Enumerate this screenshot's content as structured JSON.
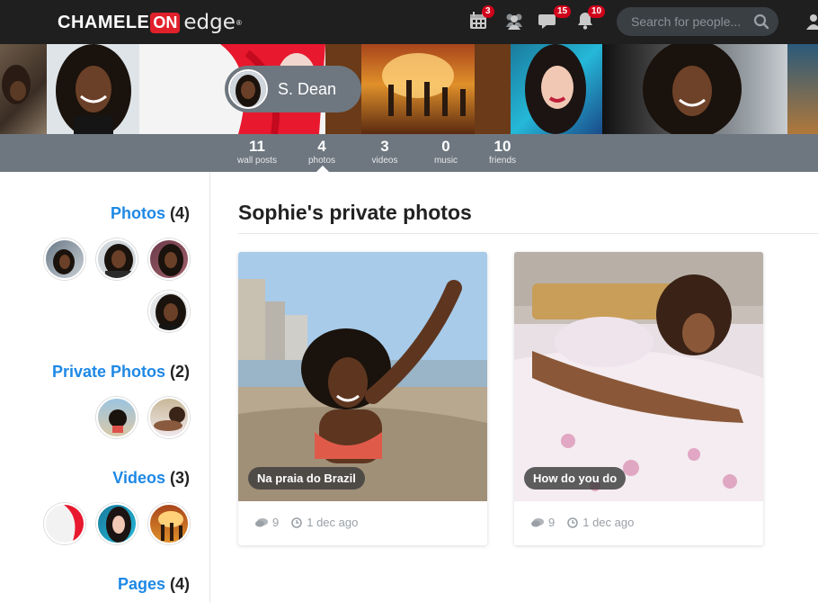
{
  "topbar": {
    "logo": {
      "brand_text": "CHAMELE",
      "on_text": "ON",
      "edge_text": "edge",
      "reg_mark": "®"
    },
    "icons": [
      {
        "name": "calendar-icon",
        "badge": "3"
      },
      {
        "name": "friends-icon",
        "badge": ""
      },
      {
        "name": "messages-icon",
        "badge": "15"
      },
      {
        "name": "notifications-icon",
        "badge": "10"
      }
    ],
    "search": {
      "placeholder": "Search for people..."
    }
  },
  "profile": {
    "name": "S. Dean"
  },
  "stats": [
    {
      "value": "11",
      "label": "wall posts"
    },
    {
      "value": "4",
      "label": "photos"
    },
    {
      "value": "3",
      "label": "videos"
    },
    {
      "value": "0",
      "label": "music"
    },
    {
      "value": "10",
      "label": "friends"
    }
  ],
  "sidebar": {
    "photos": {
      "label": "Photos",
      "count": "(4)"
    },
    "private_photos": {
      "label": "Private Photos",
      "count": "(2)"
    },
    "videos": {
      "label": "Videos",
      "count": "(3)"
    },
    "pages": {
      "label": "Pages",
      "count": "(4)"
    }
  },
  "main": {
    "title": "Sophie's private photos",
    "cards": [
      {
        "caption": "Na praia do Brazil",
        "comments": "9",
        "date": "1 dec ago"
      },
      {
        "caption": "How do you do",
        "comments": "9",
        "date": "1 dec ago"
      }
    ]
  },
  "colors": {
    "accent": "#1e88e5",
    "topbar": "#1f1f1f",
    "statsbar": "#6e7780",
    "badge": "#d0021b"
  }
}
